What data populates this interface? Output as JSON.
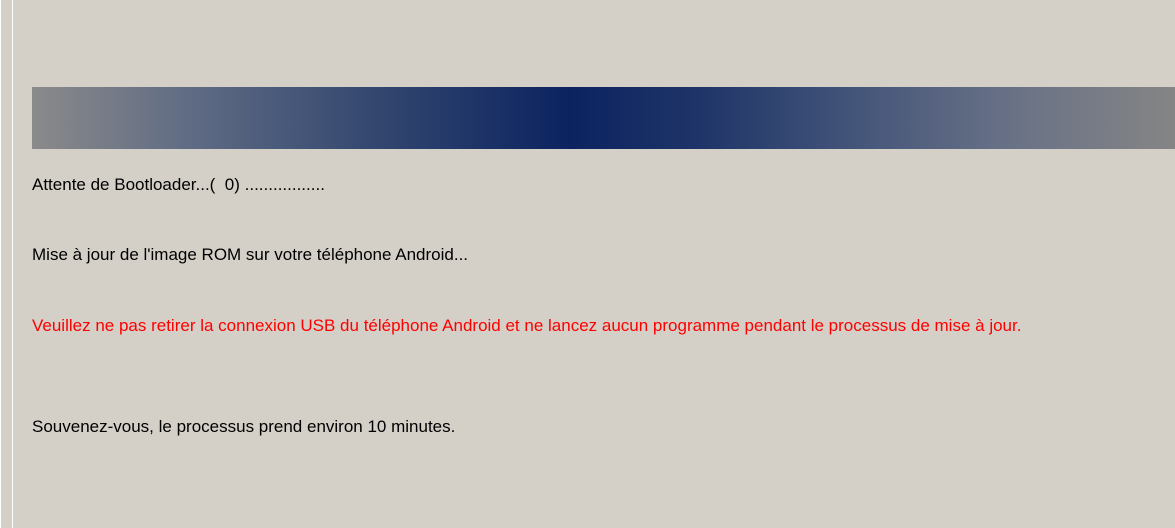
{
  "updater": {
    "progress_fraction": 0.0,
    "status_text": "Attente de Bootloader...(  0) .................",
    "updating_text": "Mise à jour de l'image ROM sur votre téléphone Android...",
    "warning_text": "Veuillez ne pas retirer la connexion USB du téléphone Android et ne lancez aucun programme pendant le processus de mise à jour.",
    "reminder_text": "Souvenez-vous, le processus prend environ 10 minutes.",
    "colors": {
      "background": "#d4d0c8",
      "warning": "#ff0000",
      "bar_center": "#0b2360",
      "bar_edge": "#858585"
    }
  }
}
